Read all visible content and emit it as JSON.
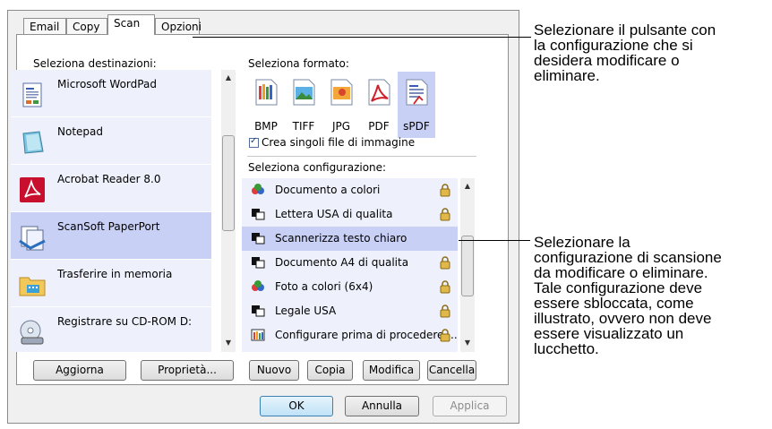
{
  "tabs": [
    {
      "label": "Email"
    },
    {
      "label": "Copy"
    },
    {
      "label": "Scan"
    },
    {
      "label": "Opzioni"
    }
  ],
  "destinations": {
    "label": "Seleziona destinazioni:",
    "items": [
      {
        "label": "Microsoft WordPad",
        "icon": "wordpad-icon"
      },
      {
        "label": "Notepad",
        "icon": "notepad-icon"
      },
      {
        "label": "Acrobat Reader 8.0",
        "icon": "acrobat-icon"
      },
      {
        "label": "ScanSoft PaperPort",
        "icon": "paperport-icon",
        "selected": true
      },
      {
        "label": "Trasferire in memoria",
        "icon": "folder-icon"
      },
      {
        "label": "Registrare su CD-ROM  D:",
        "icon": "cd-drive-icon"
      }
    ]
  },
  "format": {
    "label": "Seleziona formato:",
    "items": [
      {
        "label": "BMP"
      },
      {
        "label": "TIFF"
      },
      {
        "label": "JPG"
      },
      {
        "label": "PDF"
      },
      {
        "label": "sPDF",
        "selected": true
      }
    ],
    "checkbox_label": "Crea singoli file di immagine",
    "checkbox_checked": true
  },
  "config": {
    "label": "Seleziona configurazione:",
    "items": [
      {
        "label": "Documento a colori",
        "locked": true
      },
      {
        "label": "Lettera USA di qualita",
        "locked": true
      },
      {
        "label": "Scannerizza testo chiaro",
        "locked": false,
        "selected": true
      },
      {
        "label": "Documento A4 di qualita",
        "locked": true
      },
      {
        "label": "Foto a colori (6x4)",
        "locked": true
      },
      {
        "label": "Legale USA",
        "locked": true
      },
      {
        "label": "Configurare prima di procedere ...",
        "locked": true
      }
    ]
  },
  "buttons": {
    "aggiorna": "Aggiorna",
    "proprieta": "Proprietà...",
    "nuovo": "Nuovo",
    "copia": "Copia",
    "modifica": "Modifica",
    "cancella": "Cancella",
    "ok": "OK",
    "annulla": "Annulla",
    "applica": "Applica"
  },
  "notes": {
    "top": [
      "Selezionare il pulsante con",
      "la configurazione che si",
      "desidera modificare o",
      "eliminare."
    ],
    "bottom": [
      "Selezionare la",
      "configurazione di scansione",
      "da modificare o eliminare.",
      "Tale configurazione deve",
      "essere sbloccata, come",
      "illustrato, ovvero non deve",
      "essere visualizzato un",
      "lucchetto."
    ]
  },
  "colors": {
    "selection": "#c9d0f6",
    "list_background": "#eef1fb",
    "lock": "#e0b84a"
  }
}
